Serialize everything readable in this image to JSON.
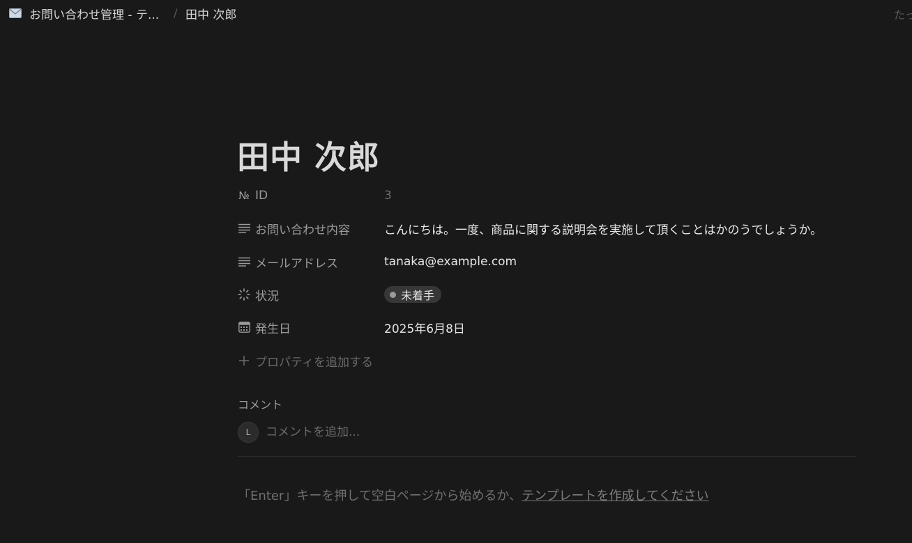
{
  "breadcrumb": {
    "database": "お問い合わせ管理 - テ...",
    "separator": "/",
    "page": "田中 次郎",
    "database_icon": "mail-icon"
  },
  "top_right_text": "たっ",
  "page": {
    "title": "田中 次郎"
  },
  "properties": [
    {
      "icon": "number-id-icon",
      "glyph": "№",
      "label": "ID",
      "value": "3"
    },
    {
      "icon": "text-lines-icon",
      "label": "お問い合わせ内容",
      "value": "こんにちは。一度、商品に関する説明会を実施して頂くことはかのうでしょうか。"
    },
    {
      "icon": "text-lines-icon",
      "label": "メールアドレス",
      "value": "tanaka@example.com"
    },
    {
      "icon": "status-spinner-icon",
      "label": "状況",
      "value": "未着手",
      "status_color": "#9b9b9b"
    },
    {
      "icon": "calendar-icon",
      "label": "発生日",
      "value": "2025年6月8日"
    }
  ],
  "add_property": {
    "label": "プロパティを追加する",
    "icon": "plus-icon"
  },
  "comments": {
    "heading": "コメント",
    "avatar_initial": "L",
    "placeholder": "コメントを追加..."
  },
  "empty_page_hint": {
    "prefix": "「Enter」キーを押して空白ページから始めるか、",
    "link": "テンプレートを作成してください"
  },
  "colors": {
    "background": "#191919",
    "text": "#d4d4d4",
    "muted": "#9b9b9b",
    "status_pill": "#373737"
  }
}
